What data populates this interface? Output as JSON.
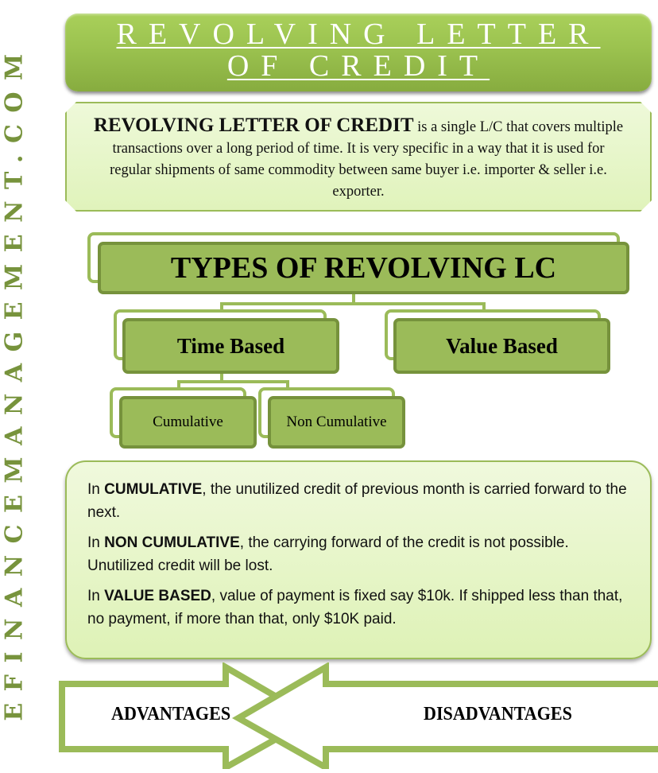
{
  "brand": {
    "vertical_text": "EFINANCEMANAGEMENT.COM",
    "color": "#77933c"
  },
  "title": {
    "line1": "REVOLVING LETTER",
    "line2": "OF CREDIT"
  },
  "definition": {
    "lead": "REVOLVING LETTER OF CREDIT",
    "text": " is a  single L/C that covers multiple transactions over a long period of time. It is very specific in a way that it is used for regular shipments of same commodity between same buyer i.e. importer & seller i.e.  exporter."
  },
  "hierarchy": {
    "root": "TYPES OF REVOLVING LC",
    "children": [
      {
        "label": "Time Based",
        "children": [
          {
            "label": "Cumulative"
          },
          {
            "label": "Non Cumulative"
          }
        ]
      },
      {
        "label": "Value Based",
        "children": []
      }
    ]
  },
  "explanations": [
    {
      "prefix": "In ",
      "term": "CUMULATIVE",
      "text": ", the unutilized credit of previous month is carried forward to the next."
    },
    {
      "prefix": "In ",
      "term": "NON CUMULATIVE",
      "text": ", the carrying forward of the credit is not possible. Unutilized credit will be lost."
    },
    {
      "prefix": "In ",
      "term": "VALUE BASED",
      "text": ", value of payment is fixed say $10k. If shipped less than that, no payment, if more than that, only $10K paid."
    }
  ],
  "arrows": {
    "left": "ADVANTAGES",
    "right": "DISADVANTAGES"
  },
  "colors": {
    "accent": "#9bbb59",
    "accent_dark": "#76923c",
    "box_light": "#e0f3bb"
  }
}
